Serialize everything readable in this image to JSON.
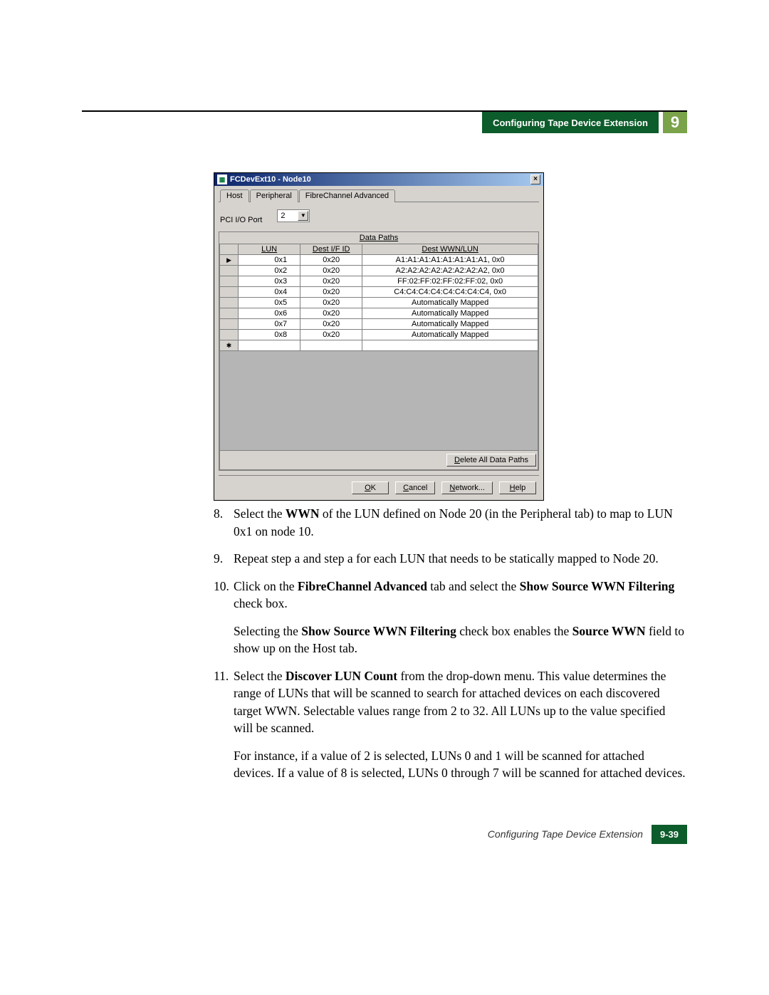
{
  "header": {
    "section_title": "Configuring Tape Device Extension",
    "chapter_number": "9"
  },
  "dialog": {
    "title": "FCDevExt10 - Node10",
    "close_glyph": "×",
    "tabs": [
      "Host",
      "Peripheral",
      "FibreChannel Advanced"
    ],
    "selected_tab_index": 0,
    "pci_label": "PCI I/O Port",
    "pci_value": "2",
    "grid_title": "Data Paths",
    "columns": [
      "LUN",
      "Dest I/F ID",
      "Dest WWN/LUN"
    ],
    "rows": [
      {
        "mark": "pointer",
        "lun": "0x1",
        "dest_if": "0x20",
        "wwn": "A1:A1:A1:A1:A1:A1:A1:A1, 0x0"
      },
      {
        "mark": "",
        "lun": "0x2",
        "dest_if": "0x20",
        "wwn": "A2:A2:A2:A2:A2:A2:A2:A2, 0x0"
      },
      {
        "mark": "",
        "lun": "0x3",
        "dest_if": "0x20",
        "wwn": "FF:02:FF:02:FF:02:FF:02, 0x0"
      },
      {
        "mark": "",
        "lun": "0x4",
        "dest_if": "0x20",
        "wwn": "C4:C4:C4:C4:C4:C4:C4:C4, 0x0"
      },
      {
        "mark": "",
        "lun": "0x5",
        "dest_if": "0x20",
        "wwn": "Automatically Mapped"
      },
      {
        "mark": "",
        "lun": "0x6",
        "dest_if": "0x20",
        "wwn": "Automatically Mapped"
      },
      {
        "mark": "",
        "lun": "0x7",
        "dest_if": "0x20",
        "wwn": "Automatically Mapped"
      },
      {
        "mark": "",
        "lun": "0x8",
        "dest_if": "0x20",
        "wwn": "Automatically Mapped"
      }
    ],
    "delete_button": "Delete All Data Paths",
    "buttons": {
      "ok": "OK",
      "cancel": "Cancel",
      "network": "Network...",
      "help": "Help"
    }
  },
  "steps": {
    "s8": {
      "num": "8.",
      "p1a": "Select the ",
      "p1b": "WWN",
      "p1c": " of the LUN defined on Node 20 (in the Peripheral tab) to map to LUN 0x1 on node 10."
    },
    "s9": {
      "num": "9.",
      "p1": "Repeat step a and step a for each LUN that needs to be statically mapped to Node 20."
    },
    "s10": {
      "num": "10.",
      "p1a": "Click on the ",
      "p1b": "FibreChannel Advanced",
      "p1c": " tab and select the ",
      "p1d": "Show Source WWN Filtering",
      "p1e": " check box.",
      "p2a": "Selecting the ",
      "p2b": "Show Source WWN Filtering",
      "p2c": " check box enables the ",
      "p2d": "Source WWN",
      "p2e": " field to show up on the Host tab."
    },
    "s11": {
      "num": "11.",
      "p1a": "Select the ",
      "p1b": "Discover LUN Count",
      "p1c": " from the drop-down menu. This value determines the range of LUNs that will be scanned to search for attached devices on each discovered target WWN. Selectable values range from 2 to 32. All LUNs up to the value specified will be scanned.",
      "p2": "For instance, if a value of 2 is selected, LUNs 0 and 1 will be scanned for attached devices. If a value of 8 is selected, LUNs 0 through 7 will be scanned for attached devices."
    }
  },
  "footer": {
    "label": "Configuring Tape Device Extension",
    "page": "9-39"
  }
}
